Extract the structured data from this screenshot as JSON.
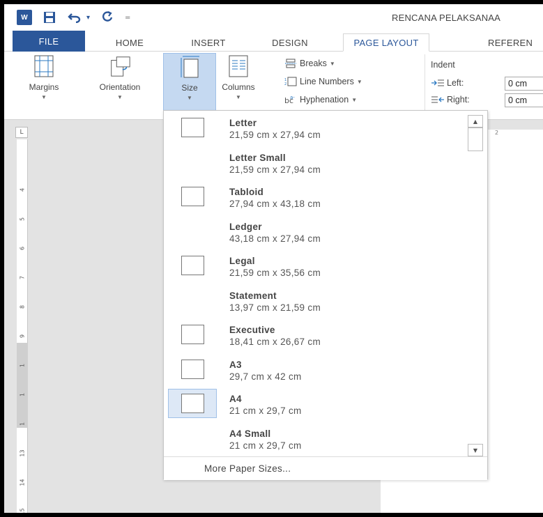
{
  "titlebar": {
    "app_badge": "W",
    "title": "RENCANA PELAKSANAA"
  },
  "tabs": [
    {
      "label": "FILE"
    },
    {
      "label": "HOME"
    },
    {
      "label": "INSERT"
    },
    {
      "label": "DESIGN"
    },
    {
      "label": "PAGE LAYOUT"
    },
    {
      "label": "REFEREN"
    }
  ],
  "ribbon": {
    "margins": "Margins",
    "orientation": "Orientation",
    "size": "Size",
    "columns": "Columns",
    "breaks": "Breaks",
    "line_numbers": "Line Numbers",
    "hyphenation": "Hyphenation",
    "indent_label": "Indent",
    "left_label": "Left:",
    "right_label": "Right:",
    "left_value": "0 cm",
    "right_value": "0 cm"
  },
  "rulers": {
    "corner": "L",
    "horizontal_tick": "2",
    "vertical_ticks": [
      "4",
      "5",
      "6",
      "7",
      "8",
      "9",
      "1",
      "1",
      "1",
      "13",
      "14",
      "15"
    ]
  },
  "paper_sizes": [
    {
      "name": "Letter",
      "size": "21,59 cm x 27,94 cm",
      "thumb": true
    },
    {
      "name": "Letter Small",
      "size": "21,59 cm x 27,94 cm",
      "thumb": false
    },
    {
      "name": "Tabloid",
      "size": "27,94 cm x 43,18 cm",
      "thumb": true
    },
    {
      "name": "Ledger",
      "size": "43,18 cm x 27,94 cm",
      "thumb": false
    },
    {
      "name": "Legal",
      "size": "21,59 cm x 35,56 cm",
      "thumb": true
    },
    {
      "name": "Statement",
      "size": "13,97 cm x 21,59 cm",
      "thumb": false
    },
    {
      "name": "Executive",
      "size": "18,41 cm x 26,67 cm",
      "thumb": true
    },
    {
      "name": "A3",
      "size": "29,7 cm x 42 cm",
      "thumb": true
    },
    {
      "name": "A4",
      "size": "21 cm x 29,7 cm",
      "thumb": true,
      "selected": true
    },
    {
      "name": "A4 Small",
      "size": "21 cm x 29,7 cm",
      "thumb": false
    }
  ],
  "more_label": "More Paper Sizes...",
  "colors": {
    "accent": "#2b579a",
    "selected_bg": "#dde8f6",
    "selected_border": "#9fc0e8"
  }
}
